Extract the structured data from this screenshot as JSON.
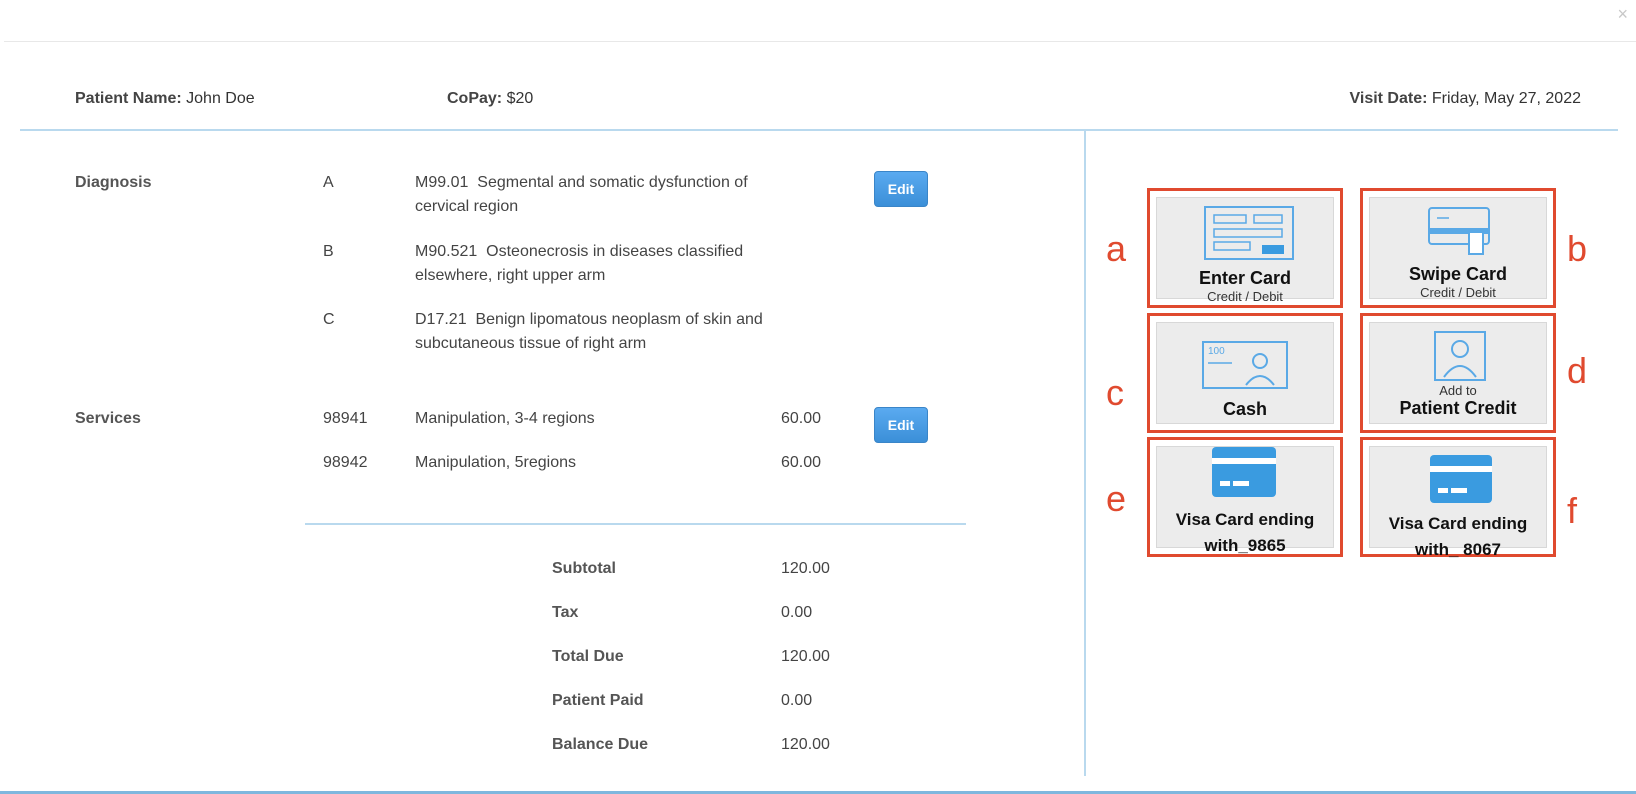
{
  "close_glyph": "×",
  "header": {
    "patient_name_label": "Patient Name:",
    "patient_name": "John Doe",
    "copay_label": "CoPay:",
    "copay": "$20",
    "visit_date_label": "Visit Date:",
    "visit_date": "Friday, May 27, 2022"
  },
  "diagnosis": {
    "label": "Diagnosis",
    "edit_label": "Edit",
    "items": [
      {
        "letter": "A",
        "code": "M99.01",
        "line1": "Segmental and somatic dysfunction of",
        "line2": "cervical region"
      },
      {
        "letter": "B",
        "code": "M90.521",
        "line1": "Osteonecrosis in diseases classified",
        "line2": "elsewhere, right upper arm"
      },
      {
        "letter": "C",
        "code": "D17.21",
        "line1": "Benign lipomatous neoplasm of skin and",
        "line2": "subcutaneous tissue of right arm"
      }
    ]
  },
  "services": {
    "label": "Services",
    "edit_label": "Edit",
    "items": [
      {
        "code": "98941",
        "desc": "Manipulation, 3-4 regions",
        "amount": "60.00"
      },
      {
        "code": "98942",
        "desc": "Manipulation, 5regions",
        "amount": "60.00"
      }
    ]
  },
  "summary": {
    "subtotal_label": "Subtotal",
    "subtotal": "120.00",
    "tax_label": "Tax",
    "tax": "0.00",
    "total_label": "Total Due",
    "total": "120.00",
    "paid_label": "Patient Paid",
    "paid": "0.00",
    "balance_label": "Balance Due",
    "balance": "120.00"
  },
  "payment": {
    "enter_card": {
      "letter": "a",
      "title": "Enter Card",
      "sub": "Credit / Debit"
    },
    "swipe_card": {
      "letter": "b",
      "title": "Swipe Card",
      "sub": "Credit / Debit"
    },
    "cash": {
      "letter": "c",
      "title": "Cash",
      "bill_value": "100"
    },
    "patient_credit": {
      "letter": "d",
      "pre": "Add to",
      "title": "Patient Credit"
    },
    "visa_9865": {
      "letter": "e",
      "line1": "Visa Card ending",
      "line2": "with_9865"
    },
    "visa_8067": {
      "letter": "f",
      "line1": "Visa Card ending",
      "line2": "with_ 8067"
    }
  },
  "colors": {
    "accent": "#3b8fd8",
    "annotation": "#e04a2f",
    "divider": "#b9d9ee",
    "card_icon": "#3a9be0"
  }
}
